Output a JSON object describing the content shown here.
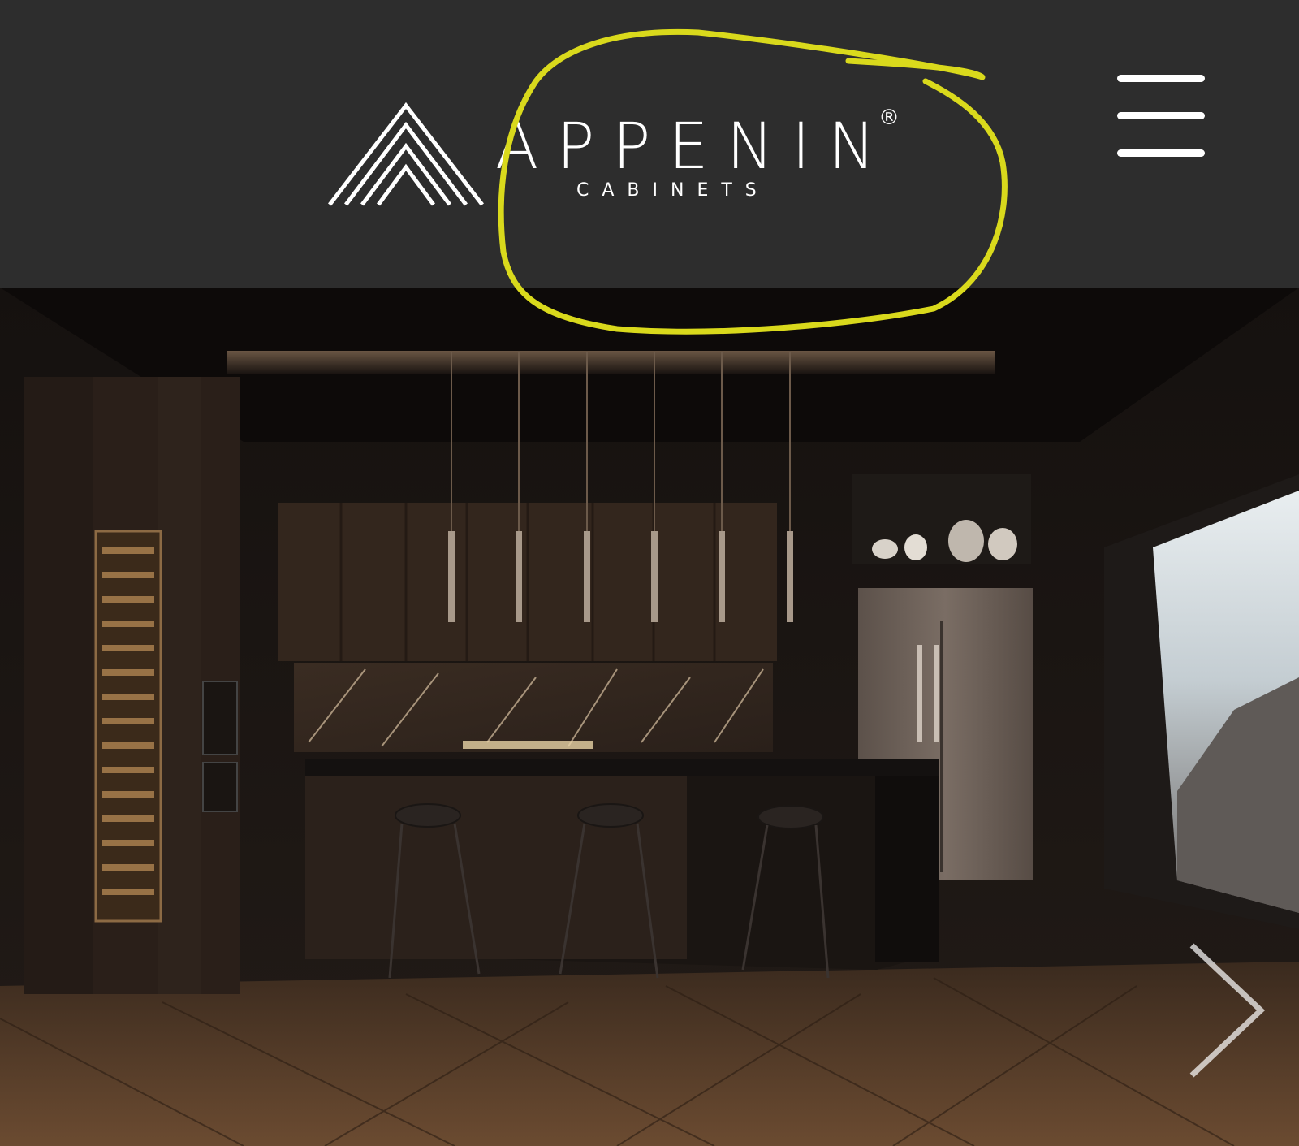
{
  "header": {
    "brand_name": "APPENIN",
    "brand_sub": "CABINETS",
    "registered_mark": "®",
    "logo_icon": "mountain-stripes-logo",
    "menu_icon": "hamburger-menu-icon"
  },
  "hero": {
    "image": "dark-kitchen-with-island-pendants-and-mountain-window",
    "next_icon": "chevron-right-icon"
  },
  "annotation": {
    "type": "hand-drawn-yellow-circle-around-brand-text",
    "color": "#d9d91c"
  },
  "colors": {
    "header_bg": "#2d2d2d",
    "logo": "#ffffff"
  }
}
